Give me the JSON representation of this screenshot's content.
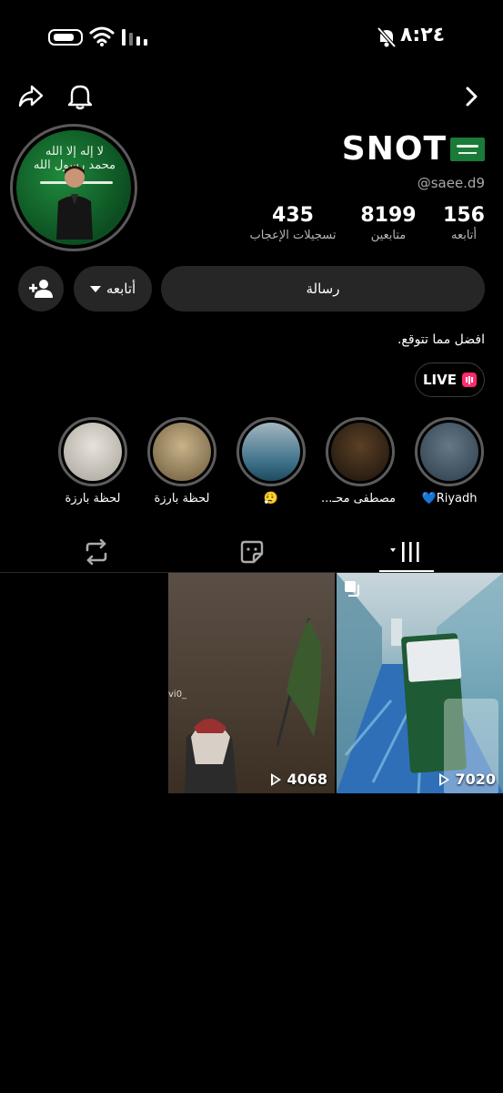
{
  "status_bar": {
    "time": "٨:٢٤"
  },
  "profile": {
    "name": "SNOT",
    "handle": "@saee.d9",
    "bio": "افضل مما تتوقع.",
    "avatar_flag_text": "لا إله إلا الله محمد رسول الله"
  },
  "stats": {
    "following": {
      "value": "156",
      "label": "أتابعه"
    },
    "followers": {
      "value": "8199",
      "label": "متابعين"
    },
    "likes": {
      "value": "435",
      "label": "تسجيلات الإعجاب"
    }
  },
  "actions": {
    "message_label": "رسالة",
    "follow_label": "أتابعه"
  },
  "live": {
    "label": "LIVE"
  },
  "highlights": [
    {
      "label": "Riyadh💙",
      "colors": [
        "#2b3d4a",
        "#667786"
      ]
    },
    {
      "label": "مصطفى محـ...",
      "colors": [
        "#3a2a16",
        "#1a120a"
      ]
    },
    {
      "label": "😮‍💨",
      "colors": [
        "#3c6f88",
        "#a2b6bf"
      ]
    },
    {
      "label": "لحظة بارزة",
      "colors": [
        "#6b5a3b",
        "#c8b389"
      ]
    },
    {
      "label": "لحظة بارزة",
      "colors": [
        "#a7a29a",
        "#e7e2da"
      ]
    }
  ],
  "tabs": [
    {
      "name": "videos",
      "active": true
    },
    {
      "name": "tagged",
      "active": false
    },
    {
      "name": "reposts",
      "active": false
    }
  ],
  "grid": [
    {
      "views": "7020"
    },
    {
      "views": "4068",
      "tag": "vi0_"
    }
  ]
}
